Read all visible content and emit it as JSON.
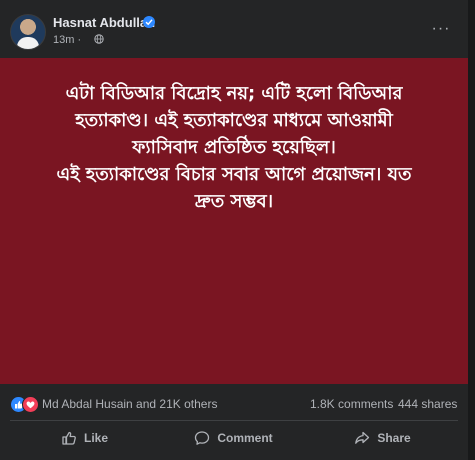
{
  "post": {
    "author": "Hasnat Abdullah",
    "time": "13m",
    "separator": "·",
    "more_label": "···",
    "lines": [
      "এটা বিডিআর বিদ্রোহ নয়; এটি হলো বিডিআর",
      "হত্যাকাণ্ড। এই হত্যাকাণ্ডের মাধ্যমে আওয়ামী",
      "ফ্যাসিবাদ প্রতিষ্ঠিত হয়েছিল।",
      "এই হত্যাকাণ্ডের বিচার সবার আগে প্রয়োজন। যত",
      "দ্রুত সম্ভব।"
    ],
    "background_color": "#7a1522"
  },
  "stats": {
    "reactions": "Md Abdal Husain and 21K others",
    "comments": "1.8K comments",
    "shares": "444 shares"
  },
  "actions": {
    "like": "Like",
    "comment": "Comment",
    "share": "Share"
  },
  "icons": {
    "verified": "verified-badge-icon",
    "privacy": "globe-icon",
    "like": "thumbs-up-icon",
    "comment": "speech-bubble-icon",
    "share": "share-arrow-icon"
  },
  "colors": {
    "card": "#242526",
    "text": "#e4e6eb",
    "muted": "#b0b3b8",
    "verified": "#2d88ff",
    "love": "#f33e58"
  }
}
